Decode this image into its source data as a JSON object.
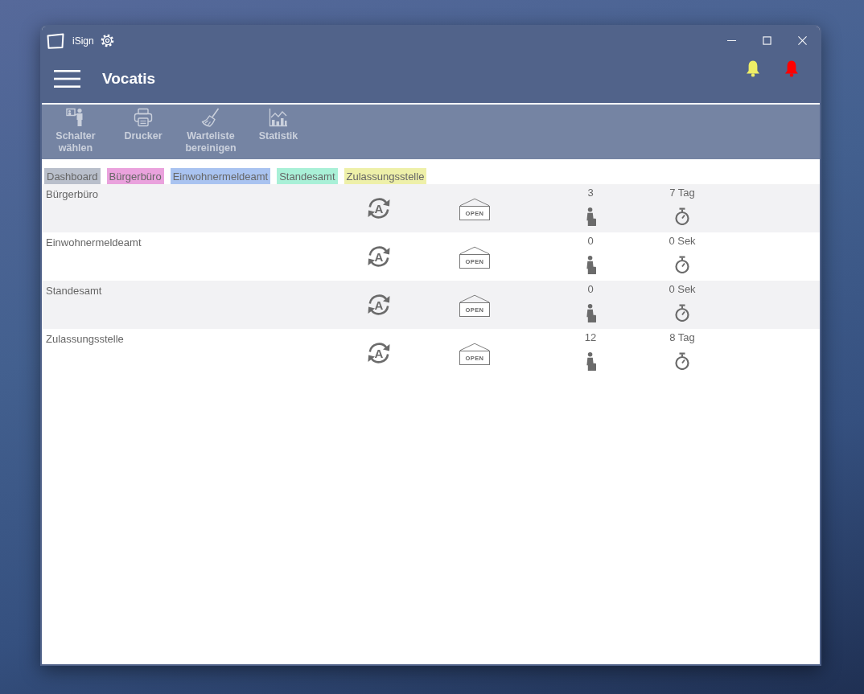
{
  "window": {
    "title": "iSign"
  },
  "header": {
    "title": "Vocatis",
    "alerts": [
      {
        "color": "#eeee66"
      },
      {
        "color": "#ff0000"
      }
    ]
  },
  "toolbar": [
    {
      "kind": "counter",
      "label": "Schalter wählen"
    },
    {
      "kind": "printer",
      "label": "Drucker"
    },
    {
      "kind": "broom",
      "label": "Warteliste bereinigen"
    },
    {
      "kind": "chart",
      "label": "Statistik"
    }
  ],
  "tabs": [
    {
      "label": "Dashboard",
      "color": "#b9bfcb"
    },
    {
      "label": "Bürgerbüro",
      "color": "#eaa2dd"
    },
    {
      "label": "Einwohnermeldeamt",
      "color": "#a9c3f0"
    },
    {
      "label": "Standesamt",
      "color": "#a9f0d7"
    },
    {
      "label": "Zulassungsstelle",
      "color": "#eef0a9"
    }
  ],
  "queues": [
    {
      "name": "Bürgerbüro",
      "mode": "A",
      "sign": "OPEN",
      "waiting": "3",
      "wait_time": "7 Tag"
    },
    {
      "name": "Einwohnermeldeamt",
      "mode": "A",
      "sign": "OPEN",
      "waiting": "0",
      "wait_time": "0 Sek"
    },
    {
      "name": "Standesamt",
      "mode": "A",
      "sign": "OPEN",
      "waiting": "0",
      "wait_time": "0 Sek"
    },
    {
      "name": "Zulassungsstelle",
      "mode": "A",
      "sign": "OPEN",
      "waiting": "12",
      "wait_time": "8 Tag"
    }
  ]
}
